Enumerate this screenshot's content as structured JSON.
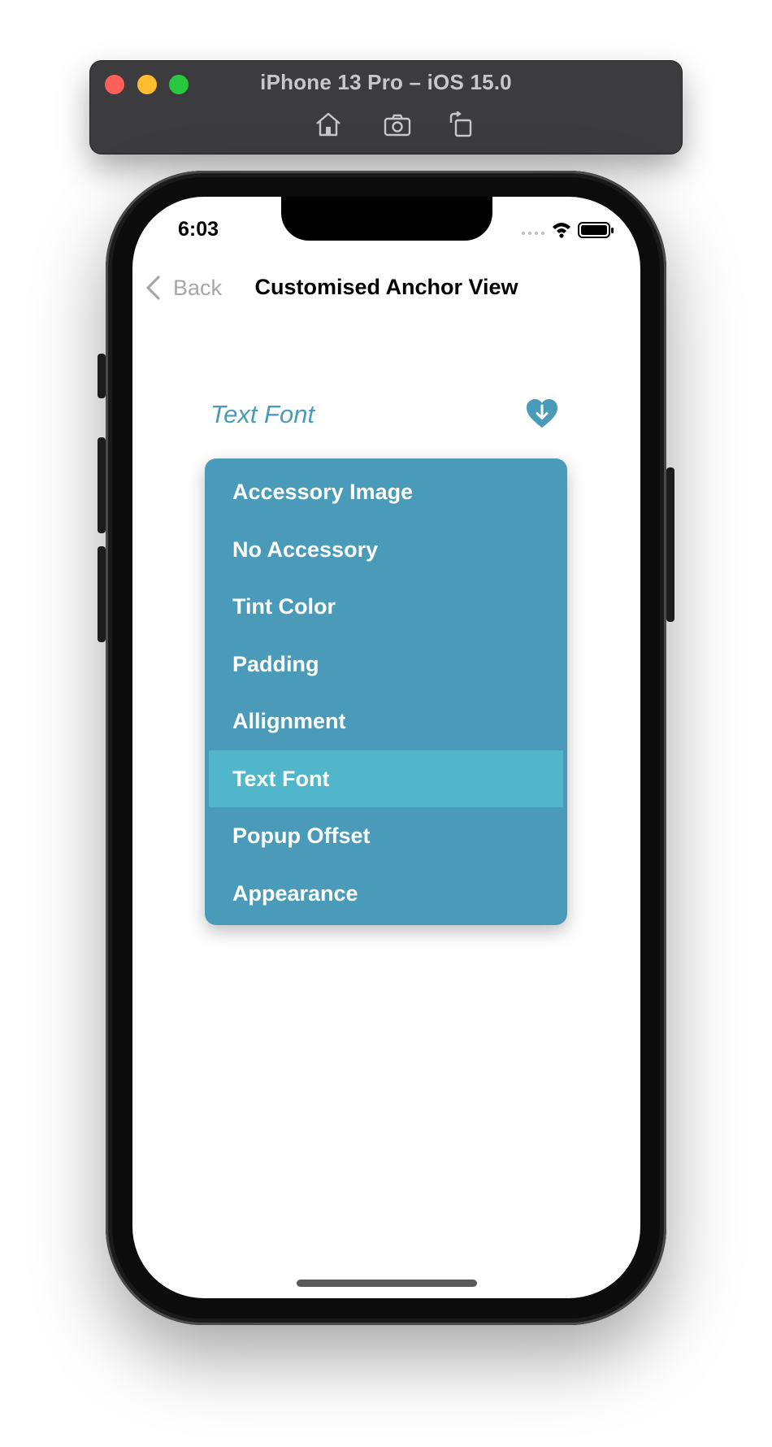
{
  "simulator": {
    "title": "iPhone 13 Pro – iOS 15.0",
    "tools": [
      "home-icon",
      "screenshot-icon",
      "rotate-icon"
    ]
  },
  "status_bar": {
    "time": "6:03",
    "icons": [
      "signal-dots-icon",
      "wifi-icon",
      "battery-icon"
    ]
  },
  "nav": {
    "back_label": "Back",
    "title": "Customised Anchor View"
  },
  "anchor": {
    "label": "Text Font",
    "icon": "heart-arrow-down-icon"
  },
  "dropdown": {
    "items": [
      {
        "label": "Accessory Image",
        "selected": false
      },
      {
        "label": "No Accessory",
        "selected": false
      },
      {
        "label": "Tint Color",
        "selected": false
      },
      {
        "label": "Padding",
        "selected": false
      },
      {
        "label": "Allignment",
        "selected": false
      },
      {
        "label": "Text Font",
        "selected": true
      },
      {
        "label": "Popup Offset",
        "selected": false
      },
      {
        "label": "Appearance",
        "selected": false
      }
    ]
  },
  "colors": {
    "accent": "#4a9bb9",
    "selected_row": "#52b6ca",
    "menu_text": "#ffffff"
  }
}
